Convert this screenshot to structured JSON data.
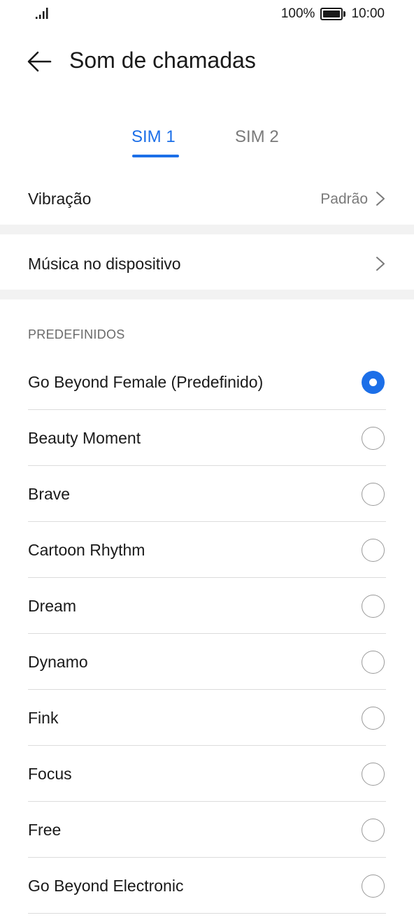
{
  "status": {
    "battery_percent": "100%",
    "time": "10:00",
    "signal_icon": "signal-icon",
    "battery_icon": "battery-icon"
  },
  "header": {
    "title": "Som de chamadas",
    "back_icon": "arrow-left-icon"
  },
  "tabs": [
    {
      "label": "SIM 1",
      "active": true
    },
    {
      "label": "SIM 2",
      "active": false
    }
  ],
  "settings": {
    "vibration": {
      "label": "Vibração",
      "value": "Padrão"
    },
    "device_music": {
      "label": "Música no dispositivo"
    }
  },
  "section": {
    "title": "PREDEFINIDOS"
  },
  "ringtones": [
    {
      "name": "Go Beyond Female (Predefinido)",
      "selected": true
    },
    {
      "name": "Beauty Moment",
      "selected": false
    },
    {
      "name": "Brave",
      "selected": false
    },
    {
      "name": "Cartoon Rhythm",
      "selected": false
    },
    {
      "name": "Dream",
      "selected": false
    },
    {
      "name": "Dynamo",
      "selected": false
    },
    {
      "name": "Fink",
      "selected": false
    },
    {
      "name": "Focus",
      "selected": false
    },
    {
      "name": "Free",
      "selected": false
    },
    {
      "name": "Go Beyond Electronic",
      "selected": false
    }
  ],
  "colors": {
    "accent": "#1c6fe8",
    "text": "#1a1a1a",
    "secondary": "#7a7a7a"
  }
}
